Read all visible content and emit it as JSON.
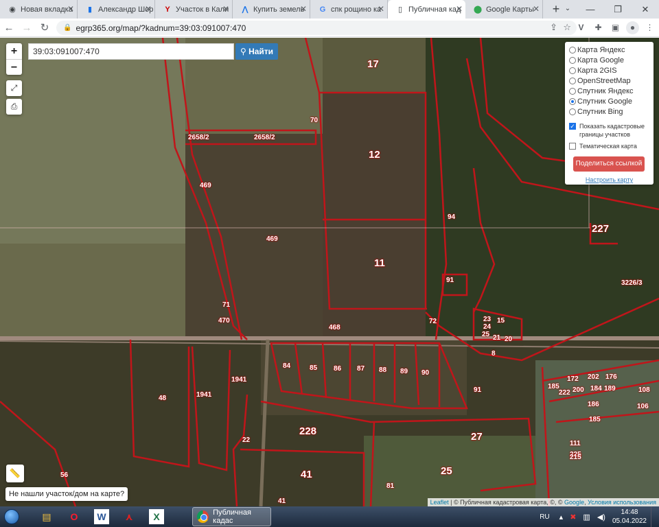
{
  "browser": {
    "tabs": [
      {
        "title": "Новая вкладка",
        "icon": "chrome-icon",
        "active": false
      },
      {
        "title": "Александр Шор",
        "icon": "chart-icon",
        "active": false
      },
      {
        "title": "Участок в Кали",
        "icon": "y-icon",
        "active": false
      },
      {
        "title": "Купить земель",
        "icon": "a-icon",
        "active": false
      },
      {
        "title": "спк рощино ка",
        "icon": "google-icon",
        "active": false
      },
      {
        "title": "Публичная кад",
        "icon": "document-icon",
        "active": true
      },
      {
        "title": "Google Карты",
        "icon": "maps-pin-icon",
        "active": false
      }
    ],
    "url": "egrp365.org/map/?kadnum=39:03:091007:470"
  },
  "map": {
    "search_value": "39:03:091007:470",
    "search_button": "Найти",
    "zoom_in": "+",
    "zoom_out": "−",
    "layers": {
      "options": [
        {
          "label": "Карта Яндекс",
          "selected": false
        },
        {
          "label": "Карта Google",
          "selected": false
        },
        {
          "label": "Карта 2GIS",
          "selected": false
        },
        {
          "label": "OpenStreetMap",
          "selected": false
        },
        {
          "label": "Спутник Яндекс",
          "selected": false
        },
        {
          "label": "Спутник Google",
          "selected": true
        },
        {
          "label": "Спутник Bing",
          "selected": false
        }
      ],
      "show_cadastral": "Показать кадастровые границы участков",
      "show_cadastral_checked": true,
      "thematic_map": "Тематическая карта",
      "thematic_checked": false,
      "share_button": "Поделиться ссылкой",
      "setup_link": "Настроить карту"
    },
    "parcel_labels": [
      "17",
      "12",
      "94",
      "11",
      "91",
      "72",
      "469",
      "469",
      "71",
      "470",
      "2658/2",
      "2658/2",
      "70",
      "468",
      "227",
      "3226/3",
      "23",
      "24",
      "15",
      "25",
      "21",
      "20",
      "8",
      "91",
      "84",
      "85",
      "86",
      "87",
      "88",
      "89",
      "90",
      "1941",
      "1941",
      "48",
      "22",
      "228",
      "27",
      "41",
      "225",
      "56",
      "41",
      "81",
      "25",
      "172",
      "202",
      "176",
      "185",
      "222",
      "200",
      "184",
      "189",
      "186",
      "111",
      "185",
      "108",
      "106",
      "215"
    ],
    "not_found": "Не нашли участок/дом на карте?",
    "attribution": {
      "leaflet": "Leaflet",
      "sep": " | ",
      "pkk": "© Публичная кадастровая карта",
      "rest": ", ©, © ",
      "google": "Google",
      "terms": "Условия использования"
    }
  },
  "taskbar": {
    "active_task": "Публичная кадас",
    "lang": "RU",
    "time": "14:48",
    "date": "05.04.2022",
    "icons": [
      "explorer-icon",
      "opera-icon",
      "word-icon",
      "pdf-icon",
      "excel-icon"
    ]
  }
}
